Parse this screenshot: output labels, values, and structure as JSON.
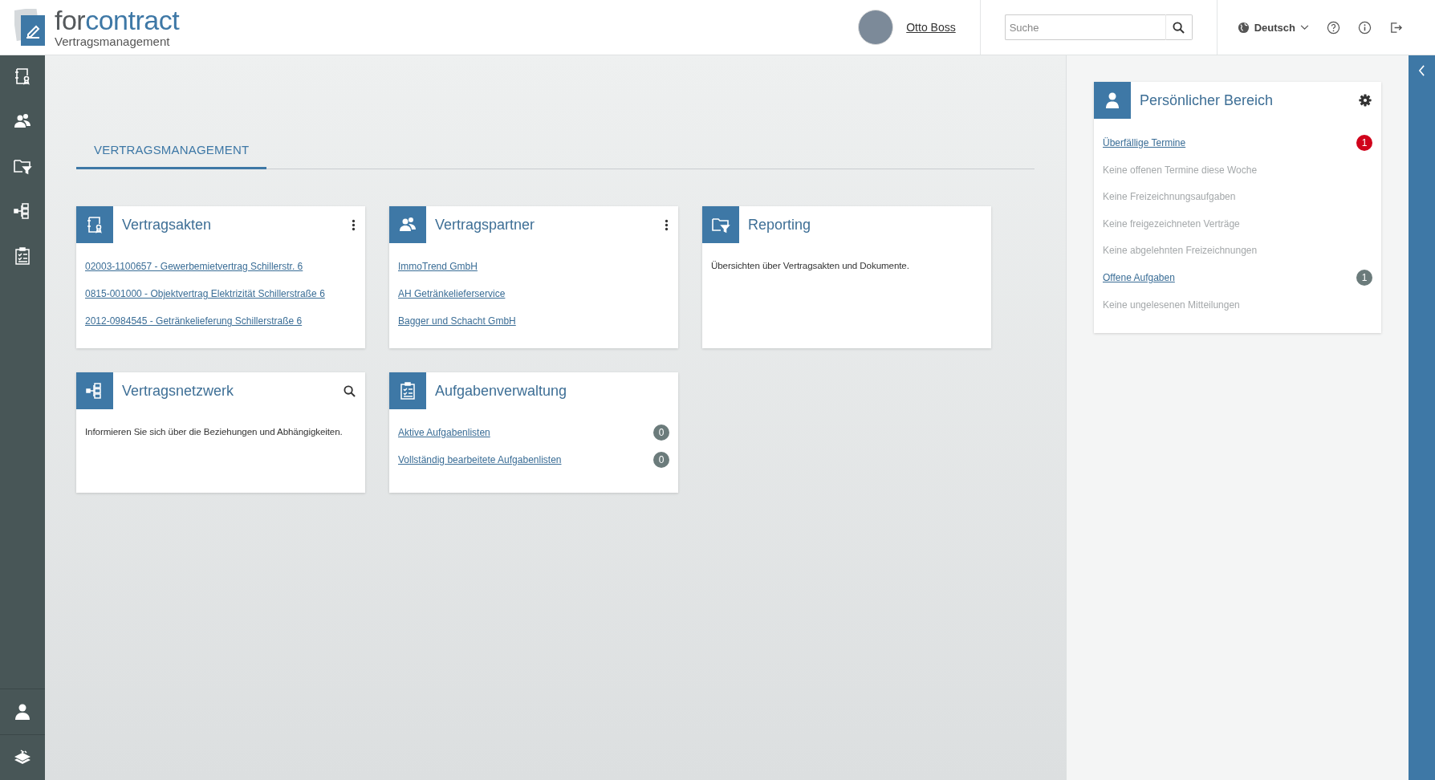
{
  "header": {
    "brand": [
      "for",
      "contract"
    ],
    "subtitle": "Vertragsmanagement",
    "user": "Otto Boss",
    "search": {
      "placeholder": "Suche"
    },
    "language": "Deutsch"
  },
  "tabs": [
    {
      "label": "VERTRAGSMANAGEMENT",
      "selected": true
    }
  ],
  "cards": [
    {
      "title": "Vertragsakten",
      "kind": "links",
      "items": [
        {
          "label": "02003-1100657 - Gewerbemietvertrag Schillerstr. 6"
        },
        {
          "label": "0815-001000 - Objektvertrag Elektrizität Schillerstraße 6"
        },
        {
          "label": "2012-0984545 - Getränkelieferung Schillerstraße 6"
        }
      ]
    },
    {
      "title": "Vertragspartner",
      "kind": "links",
      "items": [
        {
          "label": "ImmoTrend GmbH"
        },
        {
          "label": "AH Getränkelieferservice"
        },
        {
          "label": "Bagger und Schacht GmbH"
        }
      ]
    },
    {
      "title": "Reporting",
      "kind": "text",
      "text": "Übersichten über Vertragsakten und Dokumente."
    },
    {
      "title": "Vertragsnetzwerk",
      "kind": "text",
      "text": "Informieren Sie sich über die Beziehungen und Abhängigkeiten."
    },
    {
      "title": "Aufgabenverwaltung",
      "kind": "links",
      "items": [
        {
          "label": "Aktive Aufgabenlisten",
          "count": "0"
        },
        {
          "label": "Vollständig bearbeitete Aufgabenlisten",
          "count": "0"
        }
      ]
    }
  ],
  "personal": {
    "title": "Persönlicher Bereich",
    "items": [
      {
        "label": "Überfällige Termine",
        "disabled": false,
        "count": "1",
        "color": "#d0021b"
      },
      {
        "label": "Keine offenen Termine diese Woche",
        "disabled": true
      },
      {
        "label": "Keine Freizeichnungsaufgaben",
        "disabled": true
      },
      {
        "label": "Keine freigezeichneten Verträge",
        "disabled": true
      },
      {
        "label": "Keine abgelehnten Freizeichnungen",
        "disabled": true
      },
      {
        "label": "Offene Aufgaben",
        "disabled": false,
        "count": "1",
        "color": "#6b7b7b"
      },
      {
        "label": "Keine ungelesenen Mitteilungen",
        "disabled": true
      }
    ]
  }
}
